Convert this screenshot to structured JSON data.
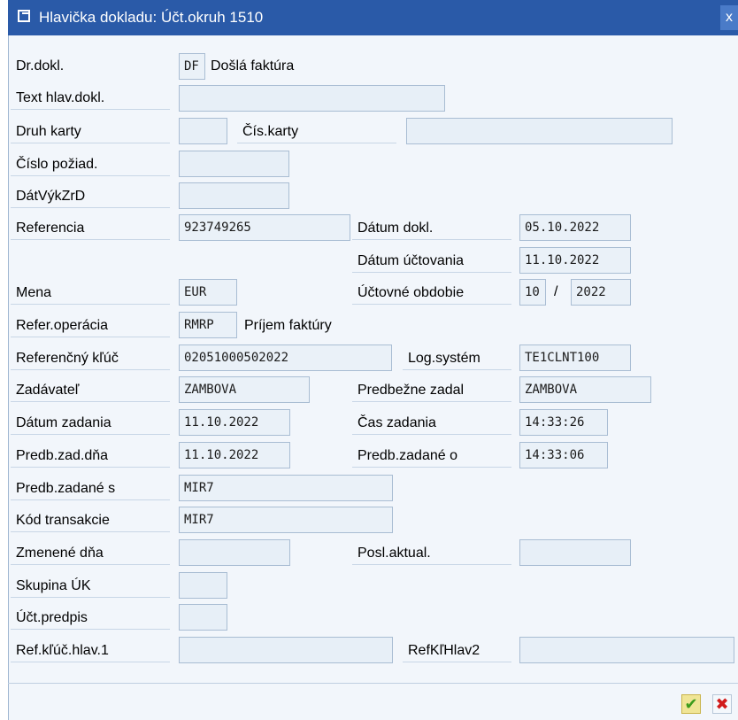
{
  "window": {
    "title": "Hlavička dokladu: Účt.okruh 1510",
    "close_symbol": "x"
  },
  "labels": {
    "dr_dokl": "Dr.dokl.",
    "text_hlav": "Text hlav.dokl.",
    "druh_karty": "Druh karty",
    "cis_karty": "Čís.karty",
    "cislo_poziad": "Číslo požiad.",
    "datvykzrd": "DátVýkZrD",
    "referencia": "Referencia",
    "datum_dokl": "Dátum dokl.",
    "datum_uct": "Dátum účtovania",
    "mena": "Mena",
    "uctovne_obdobie": "Účtovné obdobie",
    "refer_operacia": "Refer.operácia",
    "referencny_kluc": "Referenčný kľúč",
    "log_system": "Log.systém",
    "zadavatel": "Zadávateľ",
    "predbezne_zadal": "Predbežne zadal",
    "datum_zadania": "Dátum zadania",
    "cas_zadania": "Čas zadania",
    "predb_zad_dna": "Predb.zad.dňa",
    "predb_zadane_o": "Predb.zadané o",
    "predb_zadane_s": "Predb.zadané s",
    "kod_transakcie": "Kód transakcie",
    "zmenene_dna": "Zmenené dňa",
    "posl_aktual": "Posl.aktual.",
    "skupina_uk": "Skupina ÚK",
    "uct_predpis": "Účt.predpis",
    "ref_kluc_hlav1": "Ref.kľúč.hlav.1",
    "refklhlav2": "RefKľHlav2"
  },
  "values": {
    "dr_dokl_code": "DF",
    "dr_dokl_desc": "Došlá faktúra",
    "text_hlav": "",
    "druh_karty": "",
    "cis_karty": "",
    "cislo_poziad": "",
    "datvykzrd": "",
    "referencia": "923749265",
    "datum_dokl": "05.10.2022",
    "datum_uct": "11.10.2022",
    "mena": "EUR",
    "obdobie_month": "10",
    "obdobie_sep": "/",
    "obdobie_year": "2022",
    "refer_operacia_code": "RMRP",
    "refer_operacia_desc": "Príjem faktúry",
    "referencny_kluc": "02051000502022",
    "log_system": "TE1CLNT100",
    "zadavatel": "ZAMBOVA",
    "predbezne_zadal": "ZAMBOVA",
    "datum_zadania": "11.10.2022",
    "cas_zadania": "14:33:26",
    "predb_zad_dna": "11.10.2022",
    "predb_zadane_o": "14:33:06",
    "predb_zadane_s": "MIR7",
    "kod_transakcie": "MIR7",
    "zmenene_dna": "",
    "posl_aktual": "",
    "skupina_uk": "",
    "uct_predpis": "",
    "ref_kluc_hlav1": "",
    "refklhlav2": ""
  },
  "buttons": {
    "ok": "✔",
    "cancel": "✖"
  }
}
